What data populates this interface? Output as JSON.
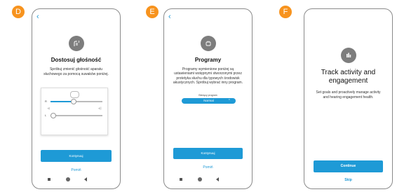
{
  "screens": [
    {
      "badge": "D",
      "back_icon": "chevron-left-icon",
      "header_icon": "hand-sound-icon",
      "title": "Dostosuj głośność",
      "description": "Spróbuj zmienić głośność aparatu słuchowego za pomocą suwaków poniżej.",
      "panel": {
        "right_label": "R",
        "left_label": "L",
        "right_level": 0.45,
        "left_level": 0.05
      },
      "primary_button": "Kontynuuj",
      "secondary_link": "Pomiń"
    },
    {
      "badge": "E",
      "back_icon": "chevron-left-icon",
      "header_icon": "program-icon",
      "title": "Programy",
      "description": "Programy wymienione poniżej są ustawieniami wstępnymi stworzonymi przez protetyka słuchu dla typowych środowisk akustycznych. Spróbuj wybrać inny program.",
      "program_label": "Bieżący program",
      "program_value": "Normal",
      "primary_button": "Kontynuuj",
      "secondary_link": "Pomiń"
    },
    {
      "badge": "F",
      "header_icon": "activity-chart-icon",
      "title": "Track activity and engagement",
      "description": "Set goals and proactively manage activity and hearing engagement health.",
      "primary_button": "Continue",
      "secondary_link": "Skip"
    }
  ],
  "colors": {
    "accent": "#1e9ad6",
    "badge": "#f7931e",
    "icon_bg": "#7d7d7d"
  }
}
